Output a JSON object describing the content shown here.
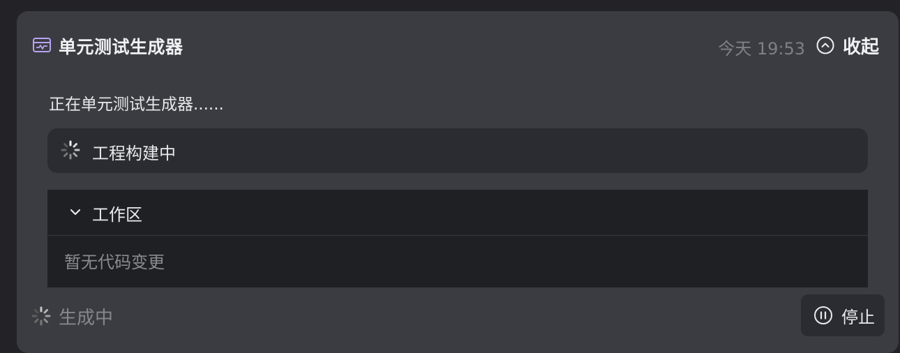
{
  "header": {
    "icon": "monitor-chart-icon",
    "title": "单元测试生成器",
    "timestamp": "今天 19:53",
    "collapse_icon": "chevron-up-circle-icon",
    "collapse_label": "收起"
  },
  "status_text": "正在单元测试生成器......",
  "task": {
    "icon": "spinner-icon",
    "label": "工程构建中"
  },
  "workspace": {
    "chevron_icon": "chevron-down-icon",
    "title": "工作区",
    "empty_text": "暂无代码变更"
  },
  "footer": {
    "status_icon": "spinner-icon",
    "status": "生成中",
    "stop_icon": "pause-circle-icon",
    "stop_label": "停止"
  },
  "colors": {
    "background": "#232327",
    "card": "#3b3c41",
    "panel": "#2b2c31",
    "workspace": "#1f2024",
    "accent_icon": "#b8a4f2",
    "muted_text": "#86878d"
  }
}
